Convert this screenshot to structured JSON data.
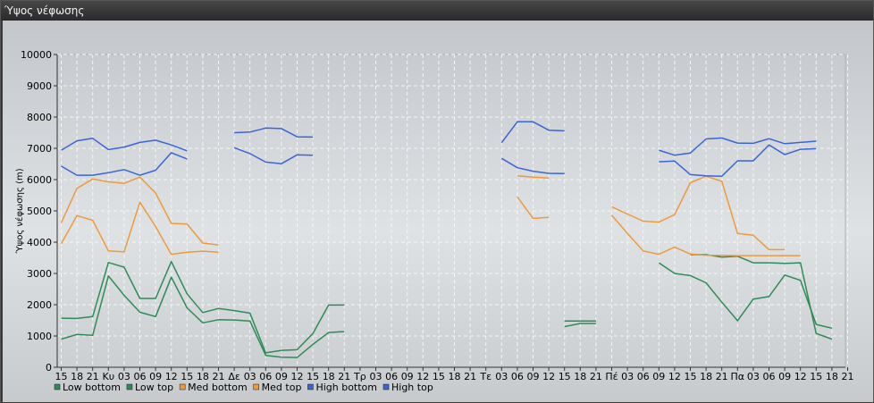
{
  "window": {
    "title": "Ύψος νέφωσης"
  },
  "chart_data": {
    "type": "line",
    "ylabel": "Ύψος νέφωσης (m)",
    "ylim": [
      0,
      10000
    ],
    "yticks": [
      0,
      1000,
      2000,
      3000,
      4000,
      5000,
      6000,
      7000,
      8000,
      9000,
      10000
    ],
    "grid": true,
    "legend": "bottom-left",
    "x": [
      "15",
      "18",
      "21",
      "Κυ",
      "03",
      "06",
      "09",
      "12",
      "15",
      "18",
      "21",
      "Δε",
      "03",
      "06",
      "09",
      "12",
      "15",
      "18",
      "21",
      "Τρ",
      "03",
      "06",
      "09",
      "12",
      "15",
      "18",
      "21",
      "Τε",
      "03",
      "06",
      "09",
      "12",
      "15",
      "18",
      "21",
      "Πέ",
      "03",
      "06",
      "09",
      "12",
      "15",
      "18",
      "21",
      "Πα",
      "03",
      "06",
      "09",
      "12",
      "15",
      "18",
      "21"
    ],
    "series": [
      {
        "name": "Low bottom",
        "color": "#2e8b57",
        "values": [
          900,
          1050,
          1020,
          2920,
          2300,
          1760,
          1620,
          2880,
          1900,
          1420,
          1520,
          1510,
          1480,
          380,
          320,
          310,
          730,
          1110,
          1140,
          null,
          null,
          null,
          null,
          null,
          null,
          null,
          null,
          null,
          null,
          null,
          null,
          null,
          1300,
          1400,
          1400,
          null,
          null,
          null,
          null,
          null,
          3600,
          3600,
          3520,
          3550,
          3340,
          3340,
          3320,
          3340,
          1080,
          900,
          null
        ]
      },
      {
        "name": "Low top",
        "color": "#2e8b57",
        "values": [
          1570,
          1560,
          1620,
          3350,
          3200,
          2200,
          2200,
          3380,
          2350,
          1750,
          1880,
          1810,
          1730,
          460,
          540,
          560,
          1080,
          1990,
          1990,
          null,
          null,
          null,
          null,
          null,
          null,
          null,
          null,
          null,
          null,
          null,
          null,
          null,
          1480,
          1480,
          1480,
          null,
          null,
          null,
          3340,
          3000,
          2930,
          2700,
          2080,
          1490,
          2180,
          2260,
          2950,
          2780,
          1370,
          1250,
          null
        ]
      },
      {
        "name": "Med bottom",
        "color": "#ee9a3a",
        "values": [
          3950,
          4850,
          4700,
          3720,
          3690,
          5280,
          4500,
          3610,
          3680,
          3710,
          3680,
          null,
          null,
          null,
          null,
          null,
          null,
          null,
          null,
          null,
          null,
          null,
          null,
          null,
          null,
          null,
          null,
          null,
          null,
          5450,
          4760,
          4790,
          null,
          null,
          null,
          4860,
          4280,
          3720,
          3610,
          3840,
          3620,
          3580,
          3580,
          3570,
          3570,
          3570,
          3570,
          3570,
          null,
          null,
          null
        ]
      },
      {
        "name": "Med top",
        "color": "#ee9a3a",
        "values": [
          4620,
          5720,
          6020,
          5930,
          5880,
          6080,
          5570,
          4600,
          4580,
          3970,
          3910,
          null,
          null,
          null,
          null,
          null,
          null,
          null,
          null,
          null,
          null,
          null,
          null,
          null,
          null,
          null,
          null,
          null,
          null,
          6120,
          6080,
          6050,
          null,
          null,
          null,
          5130,
          4900,
          4670,
          4640,
          4880,
          5900,
          6110,
          5950,
          4280,
          4220,
          3760,
          3760,
          null,
          null,
          null,
          null
        ]
      },
      {
        "name": "High bottom",
        "color": "#3a64d8",
        "values": [
          6430,
          6140,
          6140,
          6220,
          6320,
          6140,
          6300,
          6860,
          6660,
          null,
          null,
          7020,
          6830,
          6560,
          6510,
          6790,
          6780,
          null,
          null,
          null,
          null,
          null,
          null,
          null,
          null,
          null,
          null,
          null,
          6680,
          6380,
          6270,
          6200,
          6190,
          null,
          null,
          null,
          null,
          null,
          6570,
          6590,
          6160,
          6120,
          6110,
          6600,
          6600,
          7110,
          6800,
          6970,
          6990,
          null,
          null
        ]
      },
      {
        "name": "High top",
        "color": "#3a64d8",
        "values": [
          6940,
          7240,
          7320,
          6960,
          7040,
          7190,
          7260,
          7110,
          6920,
          null,
          null,
          7500,
          7520,
          7650,
          7630,
          7370,
          7360,
          null,
          null,
          null,
          null,
          null,
          null,
          null,
          null,
          null,
          null,
          null,
          7180,
          7850,
          7850,
          7580,
          7560,
          null,
          null,
          null,
          null,
          null,
          6940,
          6780,
          6850,
          7300,
          7330,
          7170,
          7160,
          7310,
          7150,
          7190,
          7230,
          null,
          null
        ]
      }
    ]
  }
}
